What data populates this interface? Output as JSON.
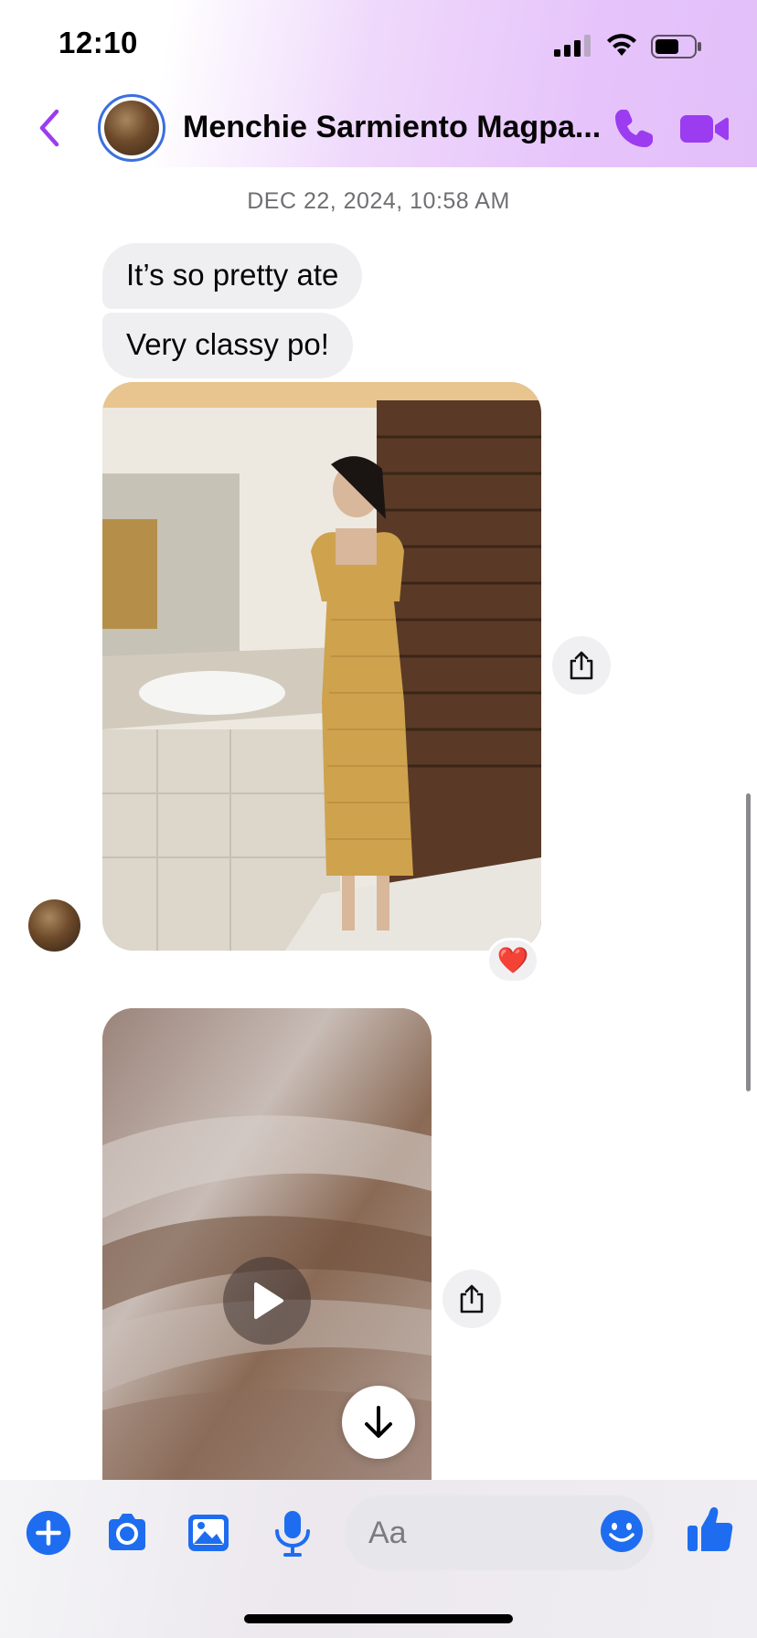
{
  "status_bar": {
    "time": "12:10",
    "icons": [
      "cellular-signal-icon",
      "wifi-icon",
      "battery-icon"
    ]
  },
  "header": {
    "back_icon": "chevron-left-icon",
    "contact_name": "Menchie Sarmiento Magpa...",
    "call_icon": "phone-icon",
    "video_icon": "video-camera-icon",
    "accent_color": "#9b3cf0"
  },
  "conversation": {
    "timestamp": "DEC 22, 2024, 10:58 AM",
    "messages": [
      {
        "type": "text",
        "text": "It’s so pretty ate"
      },
      {
        "type": "text",
        "text": "Very classy po!"
      },
      {
        "type": "photo",
        "reaction": "❤️"
      },
      {
        "type": "video"
      }
    ],
    "bubble_color": "#efeff1"
  },
  "composer": {
    "placeholder": "Aa",
    "icons": [
      "plus-circle-icon",
      "camera-icon",
      "gallery-icon",
      "microphone-icon",
      "smiley-icon",
      "thumbs-up-icon"
    ],
    "accent_color": "#1e6df0"
  }
}
